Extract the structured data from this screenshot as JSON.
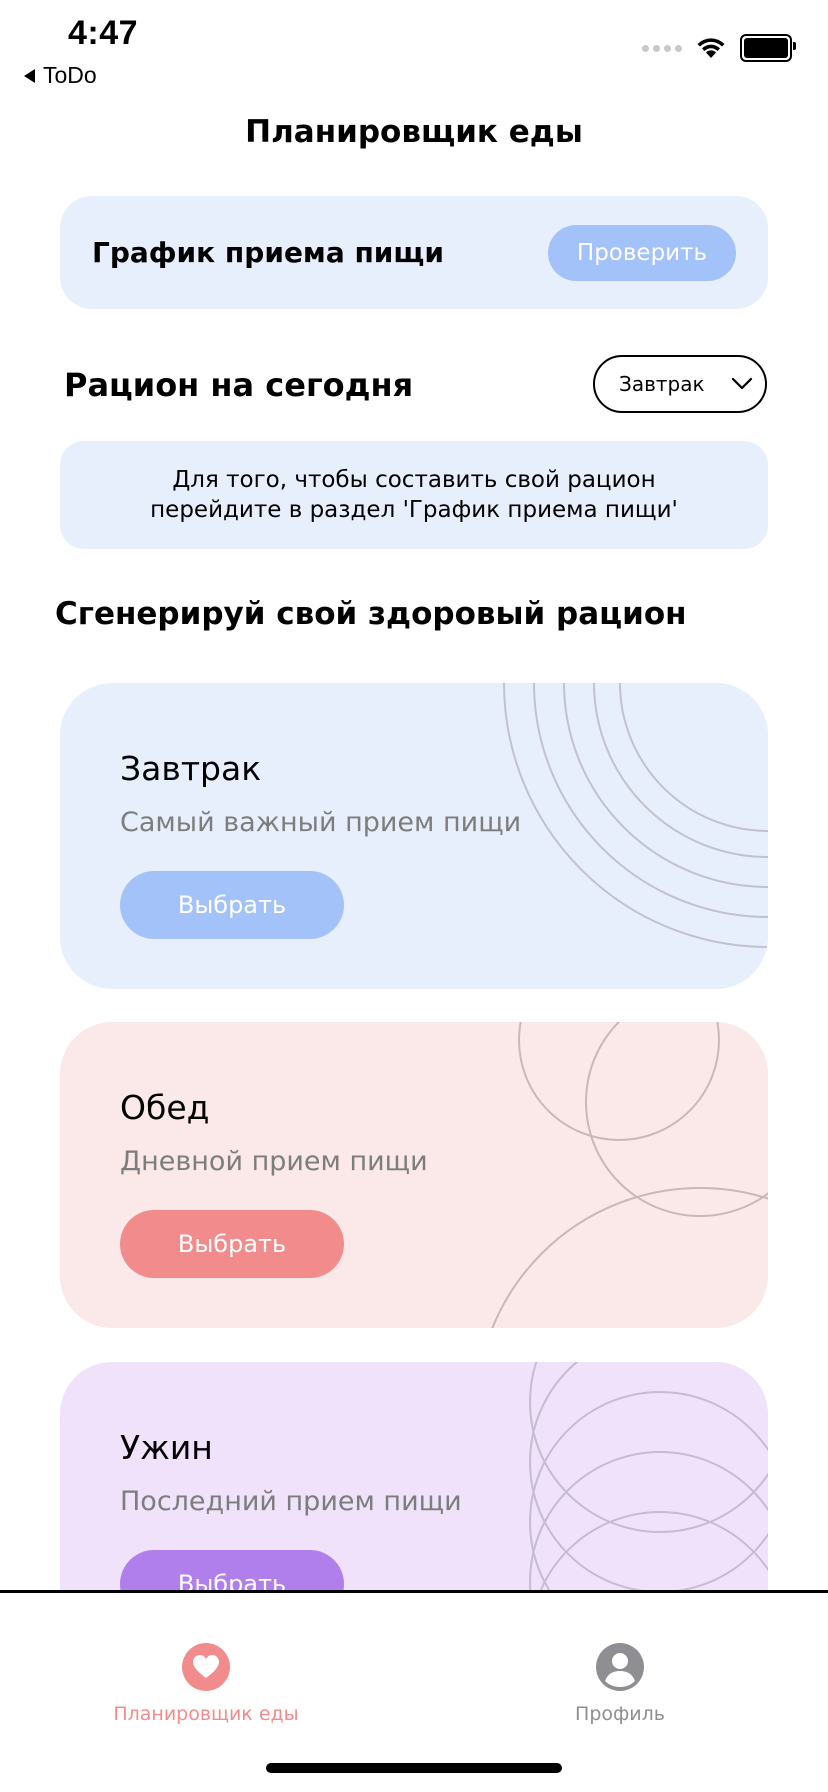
{
  "status_bar": {
    "time": "4:47",
    "back_label": "ToDo"
  },
  "header": {
    "title": "Планировщик еды"
  },
  "schedule": {
    "label": "График приема пищи",
    "check_button": "Проверить"
  },
  "ration": {
    "title": "Рацион на сегодня",
    "select_value": "Завтрак",
    "info_text": "Для того, чтобы составить свой рацион\nперейдите в раздел 'График приема пищи'"
  },
  "generate": {
    "title": "Сгенерируй свой здоровый рацион"
  },
  "meals": [
    {
      "name": "Завтрак",
      "description": "Самый важный прием пищи",
      "button": "Выбрать",
      "color": "#a3c2fa"
    },
    {
      "name": "Обед",
      "description": "Дневной прием пищи",
      "button": "Выбрать",
      "color": "#f28c8c"
    },
    {
      "name": "Ужин",
      "description": "Последний прием пищи",
      "button": "Выбрать",
      "color": "#b07fec"
    }
  ],
  "tab_bar": {
    "planner_label": "Планировщик еды",
    "profile_label": "Профиль",
    "active_color": "#f28c8c",
    "inactive_color": "#8e8e93"
  }
}
